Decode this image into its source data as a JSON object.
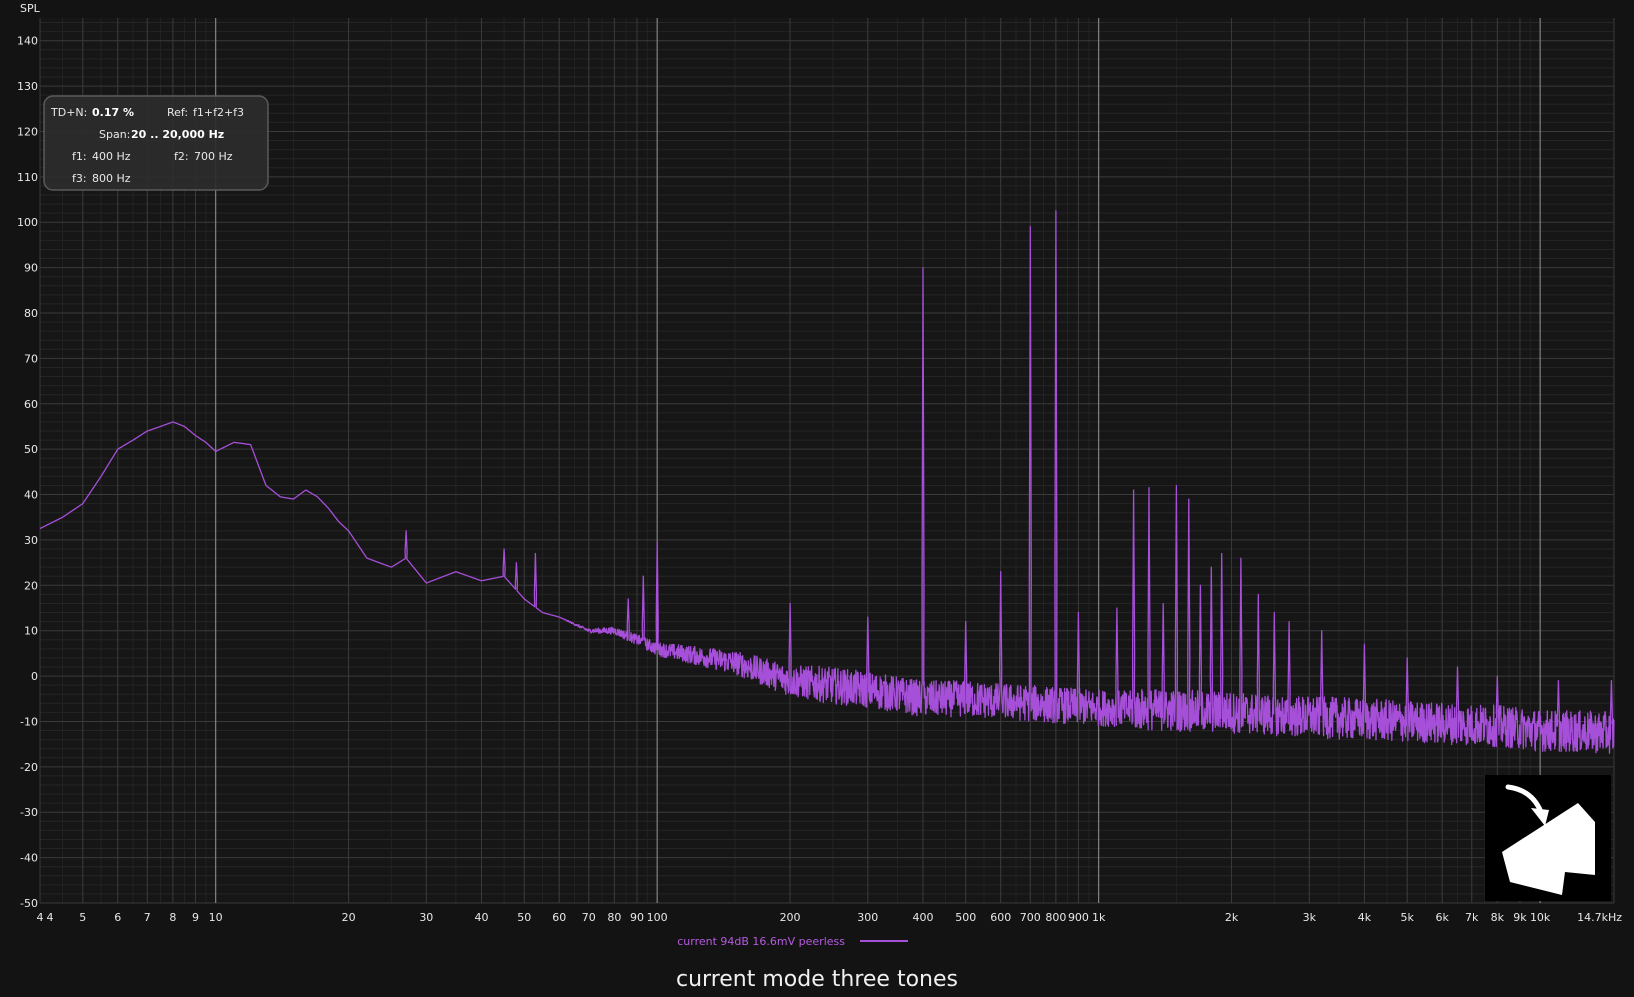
{
  "chart_data": {
    "type": "line",
    "ylabel": "SPL",
    "caption": "current mode three tones",
    "xscale": "log",
    "xlim": [
      4,
      14700
    ],
    "ylim": [
      -50,
      145
    ],
    "y_ticks": [
      140,
      130,
      120,
      110,
      100,
      90,
      80,
      70,
      60,
      50,
      40,
      30,
      20,
      10,
      0,
      -10,
      -20,
      -30,
      -40,
      -50
    ],
    "y_tick_labels": [
      "140",
      "130",
      "120",
      "110",
      "100",
      "90",
      "80",
      "70",
      "60",
      "50",
      "40",
      "30",
      "20",
      "10",
      "0",
      "-10",
      "-20",
      "-30",
      "-40",
      "-50"
    ],
    "x_ticks": [
      4,
      5,
      6,
      7,
      8,
      9,
      10,
      20,
      30,
      40,
      50,
      60,
      70,
      80,
      90,
      100,
      200,
      300,
      400,
      500,
      600,
      700,
      800,
      900,
      1000,
      2000,
      3000,
      4000,
      5000,
      6000,
      7000,
      8000,
      9000,
      10000,
      14700
    ],
    "x_tick_labels": [
      "4",
      "5",
      "6",
      "7",
      "8",
      "9",
      "10",
      "20",
      "30",
      "40",
      "50",
      "60",
      "70",
      "80",
      "90",
      "100",
      "200",
      "300",
      "400",
      "500",
      "600",
      "700",
      "800",
      "900",
      "1k",
      "2k",
      "3k",
      "4k",
      "5k",
      "6k",
      "7k",
      "8k",
      "9k",
      "10k",
      "14.7kHz"
    ],
    "x_first_label_duplicate": "4",
    "grid": true,
    "legend_position": "bottom-center",
    "series": [
      {
        "name": "current 94dB 16.6mV peerless",
        "color": "#a64fd8",
        "baseline": {
          "x": [
            4,
            4.5,
            5,
            5.5,
            6,
            6.5,
            7,
            7.5,
            8,
            8.5,
            9,
            9.5,
            10,
            11,
            12,
            13,
            14,
            15,
            16,
            17,
            18,
            19,
            20,
            22,
            25,
            27,
            30,
            35,
            40,
            45,
            50,
            55,
            60,
            70,
            80,
            90,
            100,
            150,
            200,
            300,
            400,
            500,
            700,
            1000,
            2000,
            3000,
            5000,
            8000,
            10000,
            14700
          ],
          "y": [
            32.5,
            35,
            38,
            44,
            50,
            52,
            54,
            55,
            56,
            55,
            53,
            51.5,
            49.5,
            51.5,
            51,
            42,
            39.5,
            39,
            41,
            39.5,
            37,
            34,
            32,
            26,
            24,
            26,
            20.5,
            23,
            21,
            22,
            17,
            14,
            13,
            10,
            10,
            8,
            6,
            3,
            -1,
            -3,
            -5,
            -5,
            -6,
            -7,
            -8,
            -9,
            -10,
            -11,
            -12,
            -12.5
          ]
        },
        "noise_amplitude_db": 4,
        "peaks": [
          {
            "freq": 27,
            "level": 32
          },
          {
            "freq": 45,
            "level": 28
          },
          {
            "freq": 48,
            "level": 25
          },
          {
            "freq": 53,
            "level": 27
          },
          {
            "freq": 86,
            "level": 17
          },
          {
            "freq": 93,
            "level": 22
          },
          {
            "freq": 100,
            "level": 29.5
          },
          {
            "freq": 200,
            "level": 16
          },
          {
            "freq": 300,
            "level": 13
          },
          {
            "freq": 400,
            "level": 90
          },
          {
            "freq": 500,
            "level": 12
          },
          {
            "freq": 600,
            "level": 23
          },
          {
            "freq": 700,
            "level": 99
          },
          {
            "freq": 800,
            "level": 102.5
          },
          {
            "freq": 900,
            "level": 14
          },
          {
            "freq": 1100,
            "level": 15
          },
          {
            "freq": 1200,
            "level": 41
          },
          {
            "freq": 1300,
            "level": 41.5
          },
          {
            "freq": 1400,
            "level": 16
          },
          {
            "freq": 1500,
            "level": 42
          },
          {
            "freq": 1600,
            "level": 39
          },
          {
            "freq": 1700,
            "level": 20
          },
          {
            "freq": 1800,
            "level": 24
          },
          {
            "freq": 1900,
            "level": 27
          },
          {
            "freq": 2100,
            "level": 26
          },
          {
            "freq": 2300,
            "level": 18
          },
          {
            "freq": 2500,
            "level": 14
          },
          {
            "freq": 2700,
            "level": 12
          },
          {
            "freq": 3200,
            "level": 10
          },
          {
            "freq": 4000,
            "level": 7
          },
          {
            "freq": 5000,
            "level": 4
          },
          {
            "freq": 6500,
            "level": 2
          },
          {
            "freq": 8000,
            "level": 0
          },
          {
            "freq": 11000,
            "level": -1
          },
          {
            "freq": 14500,
            "level": -1
          }
        ]
      }
    ],
    "annotations": {
      "thdn_label": "TD+N:",
      "thdn_value": "0.17 %",
      "ref_label": "Ref:",
      "ref_value": "f1+f2+f3",
      "span_label": "Span:",
      "span_value": "20 .. 20,000 Hz",
      "f1_label": "f1:",
      "f1_value": "400 Hz",
      "f2_label": "f2:",
      "f2_value": "700 Hz",
      "f3_label": "f3:",
      "f3_value": "800 Hz"
    },
    "logo_icon": "house-arrow-icon"
  }
}
